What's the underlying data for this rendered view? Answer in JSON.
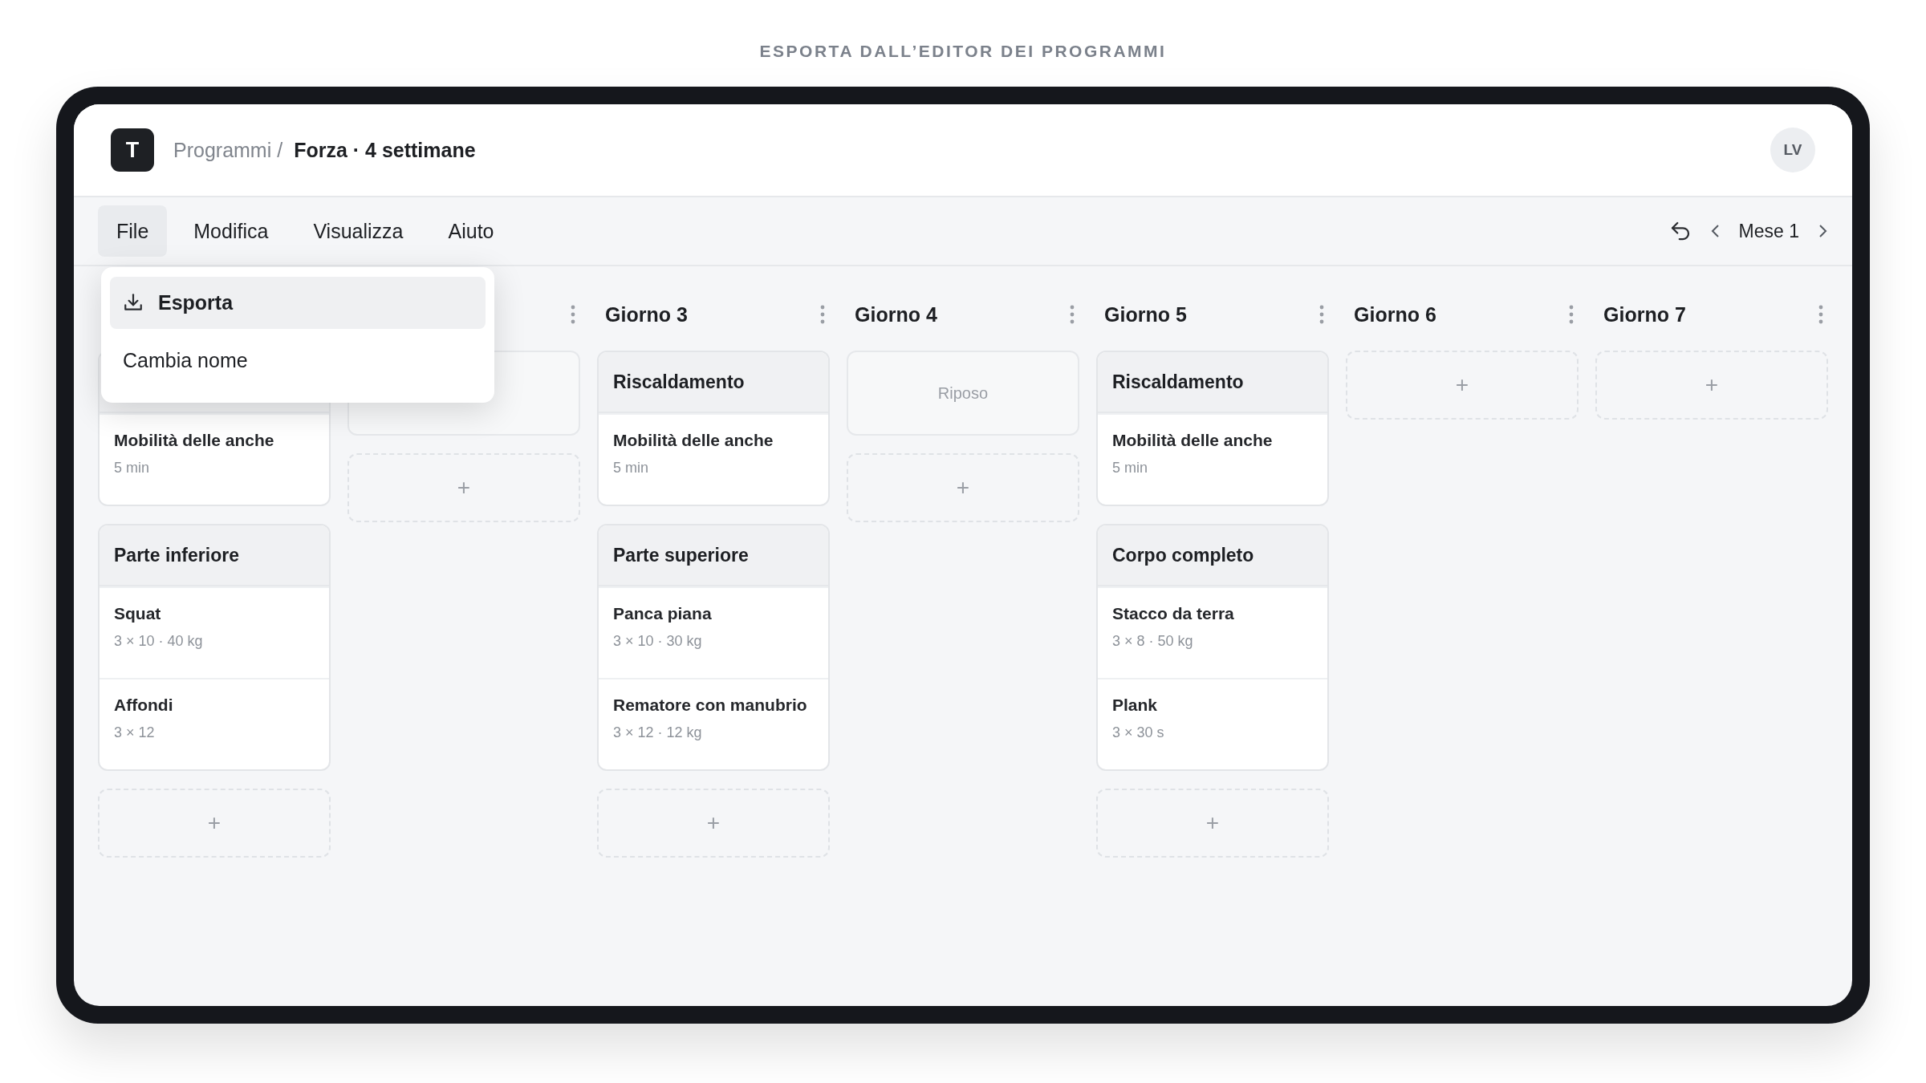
{
  "caption": "ESPORTA DALL’EDITOR DEI PROGRAMMI",
  "app": {
    "logo": "T",
    "breadcrumb": "Programmi /",
    "title": "Forza · 4 settimane",
    "avatar": "LV"
  },
  "menubar": {
    "items": [
      {
        "label": "File",
        "selected": true
      },
      {
        "label": "Modifica",
        "selected": false
      },
      {
        "label": "Visualizza",
        "selected": false
      },
      {
        "label": "Aiuto",
        "selected": false
      }
    ],
    "period": "Mese 1"
  },
  "file_menu": {
    "items": [
      {
        "label": "Esporta",
        "selected": true,
        "kind": "download"
      },
      {
        "label": "Cambia nome",
        "selected": false,
        "kind": "plain"
      }
    ]
  },
  "columns": [
    {
      "menu": false,
      "blocks": [
        {
          "kind": "workout",
          "exercises": [
            {
              "name": "Mobilità delle anche",
              "detail": "5 min"
            }
          ]
        },
        {
          "kind": "workout",
          "title": "Parte inferiore",
          "exercises": [
            {
              "name": "Squat",
              "detail": "3 × 10 · 40 kg"
            },
            {
              "name": "Affondi",
              "detail": "3 × 12"
            }
          ]
        },
        {
          "kind": "add",
          "label": "+"
        }
      ]
    },
    {
      "menu": true,
      "blocks": [
        {
          "kind": "rest"
        },
        {
          "kind": "add",
          "label": "+"
        }
      ]
    },
    {
      "title": "Giorno 3",
      "menu": true,
      "blocks": [
        {
          "kind": "workout",
          "title": "Riscaldamento",
          "exercises": [
            {
              "name": "Mobilità delle anche",
              "detail": "5 min"
            }
          ]
        },
        {
          "kind": "workout",
          "title": "Parte superiore",
          "exercises": [
            {
              "name": "Panca piana",
              "detail": "3 × 10 · 30 kg"
            },
            {
              "name": "Rematore con manubrio",
              "detail": "3 × 12 · 12 kg"
            }
          ]
        },
        {
          "kind": "add",
          "label": "+"
        }
      ]
    },
    {
      "title": "Giorno 4",
      "menu": true,
      "blocks": [
        {
          "kind": "rest",
          "label": "Riposo"
        },
        {
          "kind": "add",
          "label": "+"
        }
      ]
    },
    {
      "title": "Giorno 5",
      "menu": true,
      "blocks": [
        {
          "kind": "workout",
          "title": "Riscaldamento",
          "exercises": [
            {
              "name": "Mobilità delle anche",
              "detail": "5 min"
            }
          ]
        },
        {
          "kind": "workout",
          "title": "Corpo completo",
          "exercises": [
            {
              "name": "Stacco da terra",
              "detail": "3 × 8 · 50 kg"
            },
            {
              "name": "Plank",
              "detail": "3 × 30 s"
            }
          ]
        },
        {
          "kind": "add",
          "label": "+"
        }
      ]
    },
    {
      "title": "Giorno 6",
      "menu": true,
      "blocks": [
        {
          "kind": "add",
          "label": "+"
        }
      ]
    },
    {
      "title": "Giorno 7",
      "menu": true,
      "blocks": [
        {
          "kind": "add",
          "label": "+"
        }
      ]
    }
  ]
}
